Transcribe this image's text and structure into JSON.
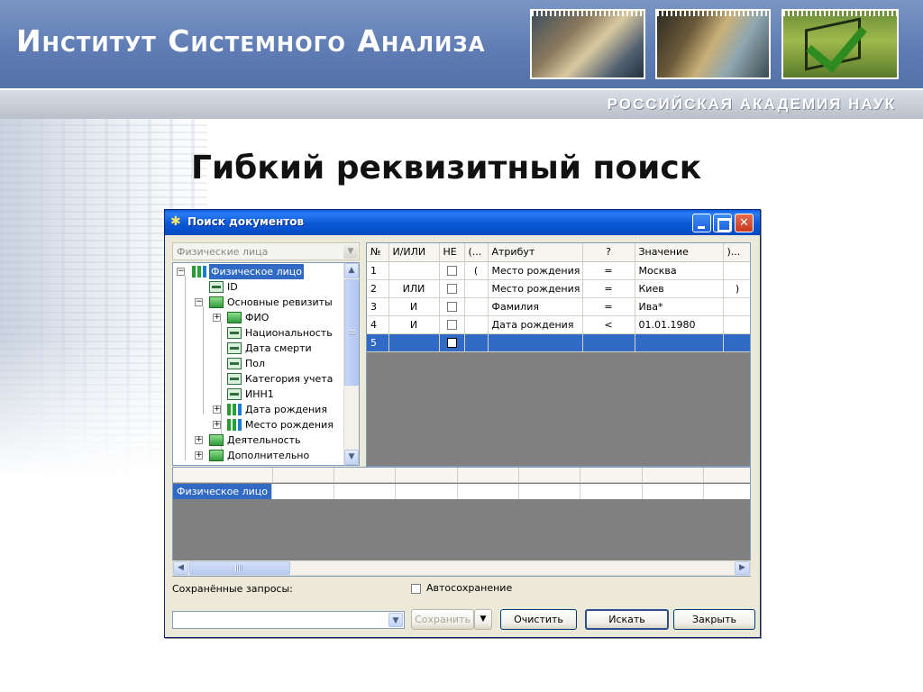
{
  "slide": {
    "institute": "Институт Системного Анализа",
    "academy": "РОССИЙСКАЯ АКАДЕМИЯ НАУК",
    "title": "Гибкий реквизитный поиск"
  },
  "window": {
    "title": "Поиск документов",
    "controls": {
      "minimize": "_",
      "maximize": "□",
      "close": "✕"
    }
  },
  "filter": {
    "value": "Физические лица",
    "arrow": "▼"
  },
  "tree": {
    "expand_plus": "+",
    "expand_minus": "−",
    "nodes": [
      {
        "label": "Физическое лицо",
        "icon": "multi-entity-icon",
        "selected": true
      },
      {
        "label": "ID",
        "icon": "field-icon"
      },
      {
        "label": "Основные ревизиты",
        "icon": "group-icon"
      },
      {
        "label": "ФИО",
        "icon": "group-icon"
      },
      {
        "label": "Национальность",
        "icon": "field-icon"
      },
      {
        "label": "Дата смерти",
        "icon": "field-icon"
      },
      {
        "label": "Пол",
        "icon": "field-icon"
      },
      {
        "label": "Категория учета",
        "icon": "field-icon"
      },
      {
        "label": "ИНН1",
        "icon": "field-icon"
      },
      {
        "label": "Дата рождения",
        "icon": "multi-entity-icon"
      },
      {
        "label": "Место рождения",
        "icon": "multi-entity-icon"
      },
      {
        "label": "Деятельность",
        "icon": "group-icon"
      },
      {
        "label": "Дополнительно",
        "icon": "group-icon"
      }
    ],
    "scroll": {
      "up": "▲",
      "down": "▼"
    }
  },
  "criteria": {
    "columns": [
      "№",
      "И/ИЛИ",
      "НЕ",
      "(...",
      "Атрибут",
      "?",
      "Значение",
      ")..."
    ],
    "rows": [
      {
        "num": "1",
        "logic": "",
        "open": "(",
        "attr": "Место рождения",
        "op": "=",
        "value": "Москва",
        "close": ""
      },
      {
        "num": "2",
        "logic": "ИЛИ",
        "open": "",
        "attr": "Место рождения",
        "op": "=",
        "value": "Киев",
        "close": ")"
      },
      {
        "num": "3",
        "logic": "И",
        "open": "",
        "attr": "Фамилия",
        "op": "=",
        "value": "Ива*",
        "close": ""
      },
      {
        "num": "4",
        "logic": "И",
        "open": "",
        "attr": "Дата рождения",
        "op": "<",
        "value": "01.01.1980",
        "close": ""
      },
      {
        "num": "5",
        "logic": "",
        "open": "",
        "attr": "",
        "op": "",
        "value": "",
        "close": ""
      }
    ]
  },
  "results": {
    "first_cell": "Физическое лицо"
  },
  "hscroll": {
    "left": "◀",
    "right": "▶"
  },
  "bottom": {
    "saved_label": "Сохранённые запросы:",
    "autosave_label": "Автосохранение",
    "saved_combo_value": "",
    "saved_combo_arrow": "▼",
    "save_button": "Сохранить",
    "save_dropdown": "▼",
    "clear_button": "Очистить",
    "search_button": "Искать",
    "close_button": "Закрыть"
  },
  "colors": {
    "selection": "#316ac5",
    "titlebar": "#0a58d8",
    "banner": "#5f7db4"
  }
}
